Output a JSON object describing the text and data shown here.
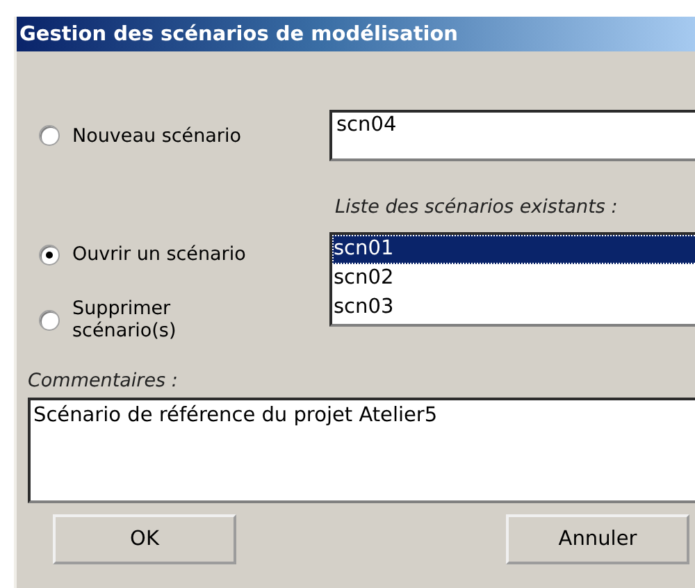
{
  "window": {
    "title": "Gestion des scénarios de modélisation"
  },
  "options": [
    {
      "label": "Nouveau scénario",
      "selected": false
    },
    {
      "label": "Ouvrir un scénario",
      "selected": true
    },
    {
      "label": "Supprimer scénario(s)",
      "selected": false
    }
  ],
  "new_scenario_field": {
    "value": "scn04"
  },
  "scenario_list": {
    "label": "Liste des scénarios existants :",
    "items": [
      {
        "label": "scn01",
        "selected": true
      },
      {
        "label": "scn02",
        "selected": false
      },
      {
        "label": "scn03",
        "selected": false
      }
    ]
  },
  "comments": {
    "label": "Commentaires :",
    "value": "Scénario de référence du projet Atelier5"
  },
  "buttons": [
    "OK",
    "Annuler"
  ]
}
